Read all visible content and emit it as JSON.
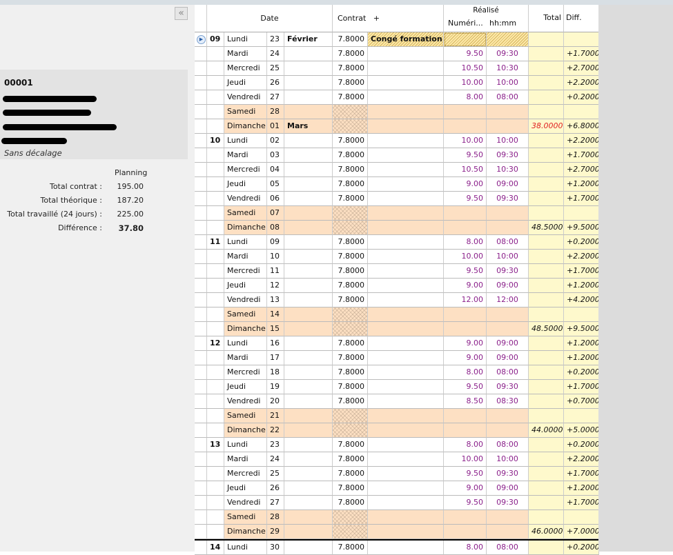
{
  "sidebar": {
    "collapse_icon": "«",
    "employee_id": "00001",
    "shift_mode": "Sans décalage",
    "summary": {
      "column": "Planning",
      "items": [
        {
          "label": "Total contrat :",
          "value": "195.00"
        },
        {
          "label": "Total théorique :",
          "value": "187.20"
        },
        {
          "label": "Total travaillé (24 jours) :",
          "value": "225.00"
        },
        {
          "label": "Différence :",
          "value": "37.80"
        }
      ]
    }
  },
  "grid": {
    "headers": {
      "date": "Date",
      "contrat": "Contrat",
      "add": "+",
      "realise": "Réalisé",
      "numeric": "Numéri...",
      "hhmm": "hh:mm",
      "total": "Total",
      "diff": "Diff."
    },
    "colors": {
      "weekend": "#fde0c3",
      "total_col": "#fef9cc",
      "realise_text": "#8a1f8a",
      "first_total": "#e02020"
    },
    "rows": [
      [
        "09",
        "Lundi",
        "23",
        "Février",
        "7.8000",
        "Congé formation...",
        "",
        "",
        "",
        ""
      ],
      [
        "",
        "Mardi",
        "24",
        "",
        "7.8000",
        "",
        "9.50",
        "09:30",
        "",
        "+1.7000"
      ],
      [
        "",
        "Mercredi",
        "25",
        "",
        "7.8000",
        "",
        "10.50",
        "10:30",
        "",
        "+2.7000"
      ],
      [
        "",
        "Jeudi",
        "26",
        "",
        "7.8000",
        "",
        "10.00",
        "10:00",
        "",
        "+2.2000"
      ],
      [
        "",
        "Vendredi",
        "27",
        "",
        "7.8000",
        "",
        "8.00",
        "08:00",
        "",
        "+0.2000"
      ],
      [
        "",
        "Samedi",
        "28",
        "",
        "",
        "",
        "",
        "",
        "",
        ""
      ],
      [
        "",
        "Dimanche",
        "01",
        "Mars",
        "",
        "",
        "",
        "",
        "38.0000",
        "+6.8000"
      ],
      [
        "10",
        "Lundi",
        "02",
        "",
        "7.8000",
        "",
        "10.00",
        "10:00",
        "",
        "+2.2000"
      ],
      [
        "",
        "Mardi",
        "03",
        "",
        "7.8000",
        "",
        "9.50",
        "09:30",
        "",
        "+1.7000"
      ],
      [
        "",
        "Mercredi",
        "04",
        "",
        "7.8000",
        "",
        "10.50",
        "10:30",
        "",
        "+2.7000"
      ],
      [
        "",
        "Jeudi",
        "05",
        "",
        "7.8000",
        "",
        "9.00",
        "09:00",
        "",
        "+1.2000"
      ],
      [
        "",
        "Vendredi",
        "06",
        "",
        "7.8000",
        "",
        "9.50",
        "09:30",
        "",
        "+1.7000"
      ],
      [
        "",
        "Samedi",
        "07",
        "",
        "",
        "",
        "",
        "",
        "",
        ""
      ],
      [
        "",
        "Dimanche",
        "08",
        "",
        "",
        "",
        "",
        "",
        "48.5000",
        "+9.5000"
      ],
      [
        "11",
        "Lundi",
        "09",
        "",
        "7.8000",
        "",
        "8.00",
        "08:00",
        "",
        "+0.2000"
      ],
      [
        "",
        "Mardi",
        "10",
        "",
        "7.8000",
        "",
        "10.00",
        "10:00",
        "",
        "+2.2000"
      ],
      [
        "",
        "Mercredi",
        "11",
        "",
        "7.8000",
        "",
        "9.50",
        "09:30",
        "",
        "+1.7000"
      ],
      [
        "",
        "Jeudi",
        "12",
        "",
        "7.8000",
        "",
        "9.00",
        "09:00",
        "",
        "+1.2000"
      ],
      [
        "",
        "Vendredi",
        "13",
        "",
        "7.8000",
        "",
        "12.00",
        "12:00",
        "",
        "+4.2000"
      ],
      [
        "",
        "Samedi",
        "14",
        "",
        "",
        "",
        "",
        "",
        "",
        ""
      ],
      [
        "",
        "Dimanche",
        "15",
        "",
        "",
        "",
        "",
        "",
        "48.5000",
        "+9.5000"
      ],
      [
        "12",
        "Lundi",
        "16",
        "",
        "7.8000",
        "",
        "9.00",
        "09:00",
        "",
        "+1.2000"
      ],
      [
        "",
        "Mardi",
        "17",
        "",
        "7.8000",
        "",
        "9.00",
        "09:00",
        "",
        "+1.2000"
      ],
      [
        "",
        "Mercredi",
        "18",
        "",
        "7.8000",
        "",
        "8.00",
        "08:00",
        "",
        "+0.2000"
      ],
      [
        "",
        "Jeudi",
        "19",
        "",
        "7.8000",
        "",
        "9.50",
        "09:30",
        "",
        "+1.7000"
      ],
      [
        "",
        "Vendredi",
        "20",
        "",
        "7.8000",
        "",
        "8.50",
        "08:30",
        "",
        "+0.7000"
      ],
      [
        "",
        "Samedi",
        "21",
        "",
        "",
        "",
        "",
        "",
        "",
        ""
      ],
      [
        "",
        "Dimanche",
        "22",
        "",
        "",
        "",
        "",
        "",
        "44.0000",
        "+5.0000"
      ],
      [
        "13",
        "Lundi",
        "23",
        "",
        "7.8000",
        "",
        "8.00",
        "08:00",
        "",
        "+0.2000"
      ],
      [
        "",
        "Mardi",
        "24",
        "",
        "7.8000",
        "",
        "10.00",
        "10:00",
        "",
        "+2.2000"
      ],
      [
        "",
        "Mercredi",
        "25",
        "",
        "7.8000",
        "",
        "9.50",
        "09:30",
        "",
        "+1.7000"
      ],
      [
        "",
        "Jeudi",
        "26",
        "",
        "7.8000",
        "",
        "9.00",
        "09:00",
        "",
        "+1.2000"
      ],
      [
        "",
        "Vendredi",
        "27",
        "",
        "7.8000",
        "",
        "9.50",
        "09:30",
        "",
        "+1.7000"
      ],
      [
        "",
        "Samedi",
        "28",
        "",
        "",
        "",
        "",
        "",
        "",
        ""
      ],
      [
        "",
        "Dimanche",
        "29",
        "",
        "",
        "",
        "",
        "",
        "46.0000",
        "+7.0000"
      ],
      [
        "14",
        "Lundi",
        "30",
        "",
        "7.8000",
        "",
        "8.00",
        "08:00",
        "",
        "+0.2000"
      ]
    ]
  }
}
